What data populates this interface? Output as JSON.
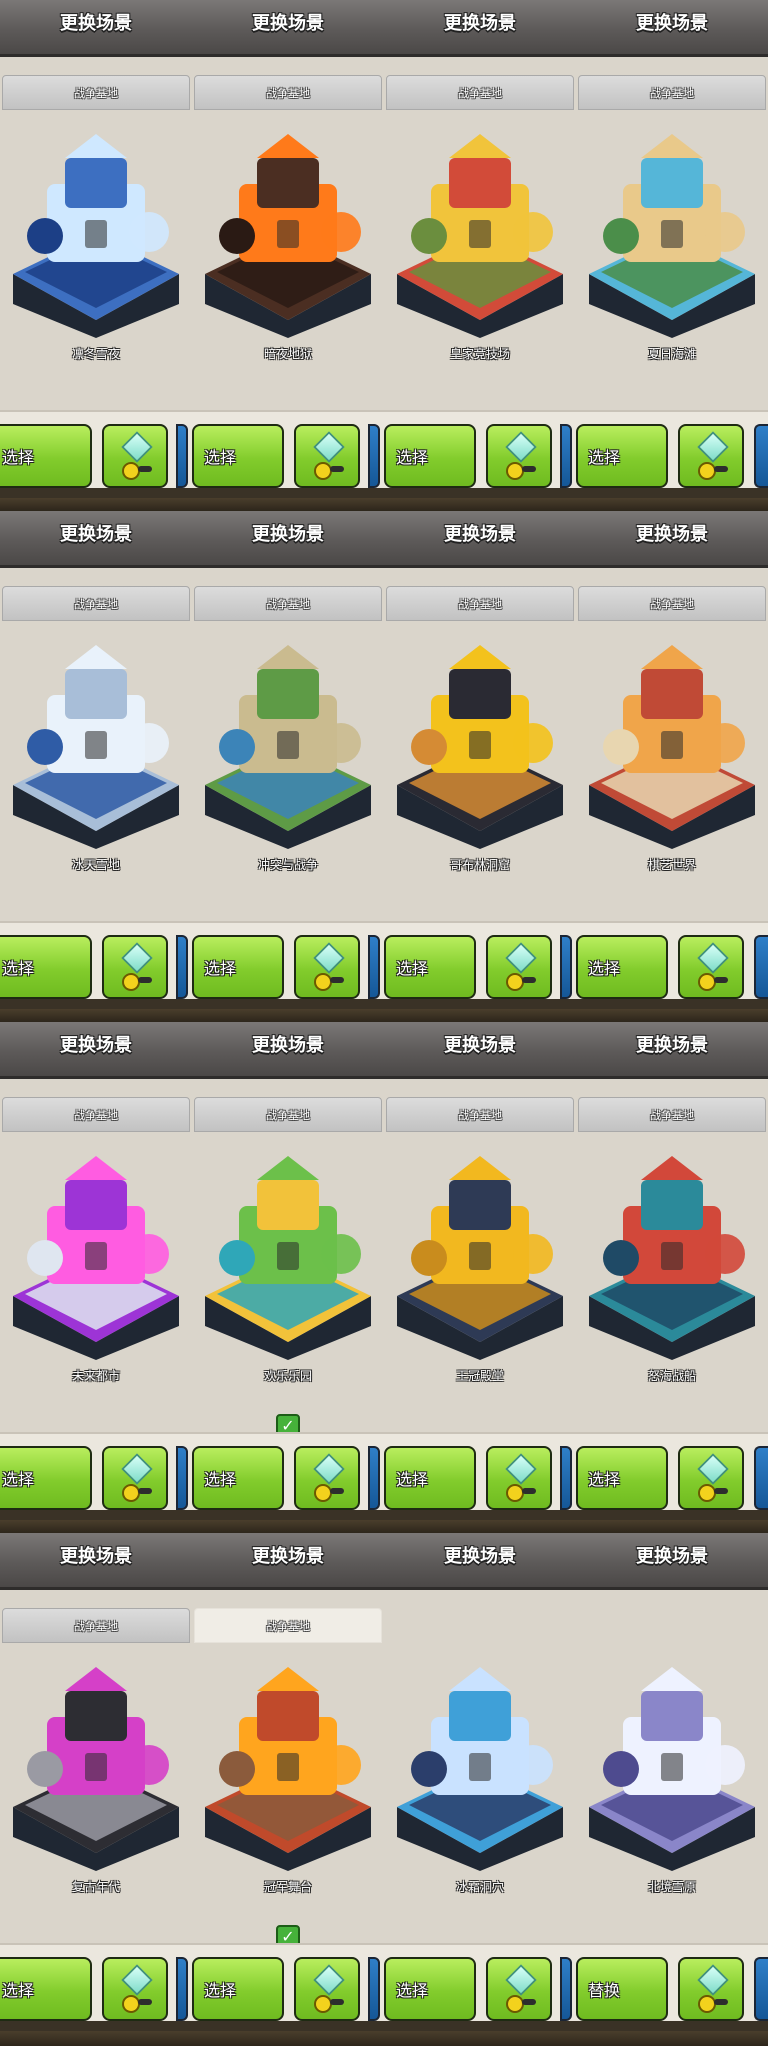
{
  "header_title": "更换场景",
  "tab_label": "战争基地",
  "select_label": "选择",
  "replace_label": "替换",
  "panels": [
    {
      "scenes": [
        {
          "name": "凛冬雪夜",
          "tab": true,
          "active": false,
          "checked": false,
          "theme": [
            "#cfe8ff",
            "#3d6fc1",
            "#1c3f86"
          ]
        },
        {
          "name": "暗夜地狱",
          "tab": true,
          "active": false,
          "checked": false,
          "theme": [
            "#ff7a1a",
            "#4b2e22",
            "#2a1a14"
          ]
        },
        {
          "name": "皇家竞技场",
          "tab": true,
          "active": false,
          "checked": false,
          "theme": [
            "#f1c43b",
            "#d24b39",
            "#6b8e3e"
          ]
        },
        {
          "name": "夏日海滩",
          "tab": true,
          "active": false,
          "checked": false,
          "theme": [
            "#e9c98a",
            "#55b6d8",
            "#4b8e4a"
          ]
        }
      ]
    },
    {
      "scenes": [
        {
          "name": "冰天雪地",
          "tab": true,
          "active": false,
          "checked": false,
          "theme": [
            "#e9f2fb",
            "#a8bed8",
            "#2f5ca6"
          ]
        },
        {
          "name": "冲突与战争",
          "tab": true,
          "active": false,
          "checked": false,
          "theme": [
            "#cabb8f",
            "#5e9b46",
            "#3c84b8"
          ]
        },
        {
          "name": "哥布林洞窟",
          "tab": true,
          "active": false,
          "checked": false,
          "theme": [
            "#f3c21c",
            "#2a2a33",
            "#d58b34"
          ]
        },
        {
          "name": "棋艺世界",
          "tab": true,
          "active": false,
          "checked": false,
          "theme": [
            "#f0a54a",
            "#c04a36",
            "#e8d6b0"
          ]
        }
      ]
    },
    {
      "scenes": [
        {
          "name": "未来都市",
          "tab": true,
          "active": false,
          "checked": false,
          "theme": [
            "#ff5ce1",
            "#9d34d6",
            "#dfe6f0"
          ]
        },
        {
          "name": "欢乐乐园",
          "tab": true,
          "active": false,
          "checked": true,
          "theme": [
            "#6cc04a",
            "#f2c23a",
            "#2fa7b8"
          ]
        },
        {
          "name": "王冠殿堂",
          "tab": true,
          "active": false,
          "checked": false,
          "theme": [
            "#f2b81f",
            "#2e3a55",
            "#c98c1d"
          ]
        },
        {
          "name": "怒海战船",
          "tab": true,
          "active": false,
          "checked": false,
          "theme": [
            "#d2483a",
            "#2b8a9a",
            "#1f4a66"
          ]
        }
      ]
    },
    {
      "scenes": [
        {
          "name": "复古年代",
          "tab": true,
          "active": false,
          "checked": false,
          "theme": [
            "#d540c8",
            "#2d2d33",
            "#9a9aa3"
          ]
        },
        {
          "name": "冠军舞台",
          "tab": true,
          "active": true,
          "checked": true,
          "theme": [
            "#ffa51e",
            "#c04a2b",
            "#8b5b3c"
          ]
        },
        {
          "name": "冰霜洞穴",
          "tab": false,
          "active": false,
          "checked": false,
          "theme": [
            "#c9e2ff",
            "#3fa0d8",
            "#2b3e6b"
          ]
        },
        {
          "name": "北境雪原",
          "tab": false,
          "active": false,
          "checked": false,
          "theme": [
            "#eef2ff",
            "#8a86c9",
            "#4e4b8f"
          ]
        }
      ]
    }
  ],
  "button_rows": [
    [
      "选择",
      "选择",
      "选择",
      "选择"
    ],
    [
      "选择",
      "选择",
      "选择",
      "选择"
    ],
    [
      "选择",
      "选择",
      "选择",
      "选择"
    ],
    [
      "选择",
      "选择",
      "选择",
      "替换"
    ]
  ]
}
